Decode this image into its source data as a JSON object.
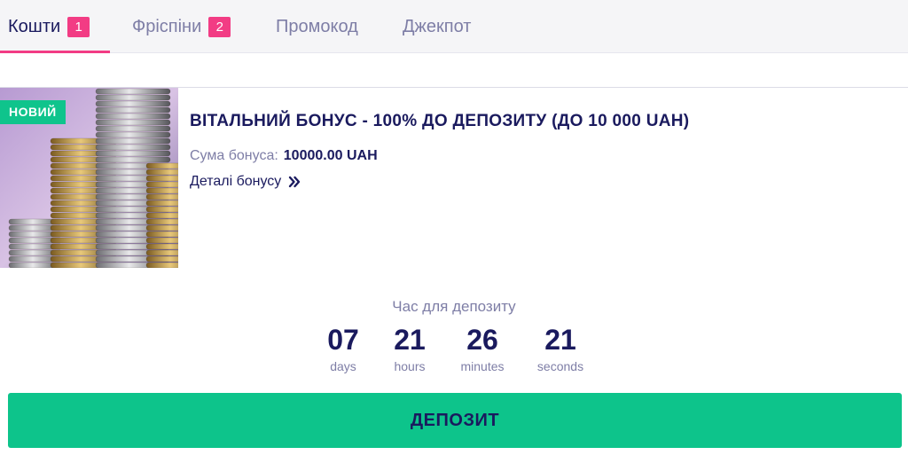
{
  "tabs": [
    {
      "label": "Кошти",
      "badge": "1",
      "active": true
    },
    {
      "label": "Фріспіни",
      "badge": "2",
      "active": false
    },
    {
      "label": "Промокод",
      "badge": null,
      "active": false
    },
    {
      "label": "Джекпот",
      "badge": null,
      "active": false
    }
  ],
  "bonus": {
    "new_badge": "НОВИЙ",
    "image_icon": "coin-stacks-image",
    "title": "ВІТАЛЬНИЙ БОНУС - 100% ДО ДЕПОЗИТУ (ДО 10 000 UAH)",
    "sum_label": "Сума бонуса:",
    "sum_value": "10000.00 UAH",
    "details_label": "Деталі бонусу",
    "details_icon": "double-chevron-right-icon"
  },
  "countdown": {
    "title": "Час для депозиту",
    "days": {
      "value": "07",
      "label": "days"
    },
    "hours": {
      "value": "21",
      "label": "hours"
    },
    "minutes": {
      "value": "26",
      "label": "minutes"
    },
    "seconds": {
      "value": "21",
      "label": "seconds"
    }
  },
  "deposit_button": "ДЕПОЗИТ",
  "colors": {
    "accent_pink": "#f23c84",
    "accent_green": "#0dc48b",
    "text_dark": "#1a1a5e",
    "text_muted": "#7e7ea6"
  }
}
